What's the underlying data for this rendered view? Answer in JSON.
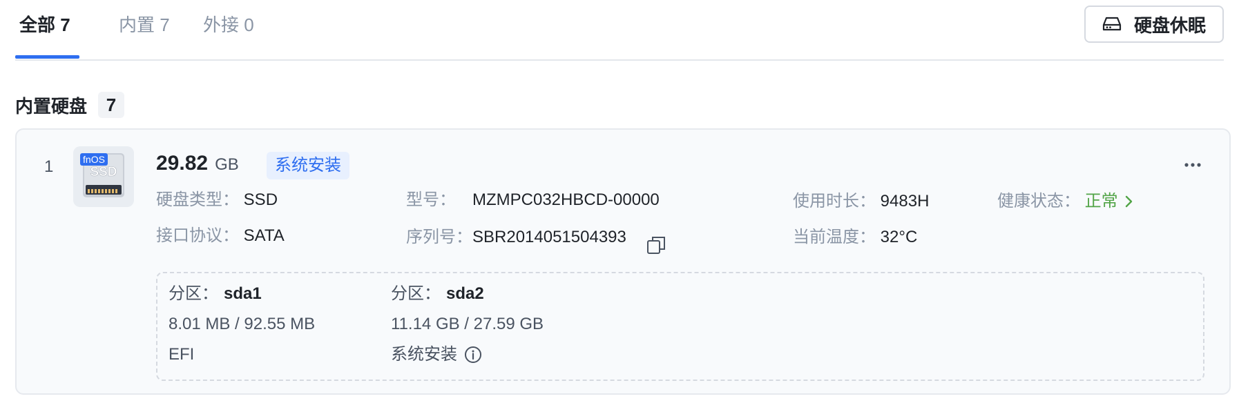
{
  "tabs": [
    {
      "label": "全部 7",
      "active": true
    },
    {
      "label": "内置 7",
      "active": false
    },
    {
      "label": "外接 0",
      "active": false
    }
  ],
  "sleep_button": {
    "label": "硬盘休眠",
    "icon": "hard-drive-icon"
  },
  "section": {
    "title": "内置硬盘",
    "count": "7"
  },
  "disk": {
    "index": "1",
    "image": {
      "badge": "fnOS",
      "label": "SSD"
    },
    "size_value": "29.82",
    "size_unit": "GB",
    "tag": "系统安装",
    "fields": {
      "type": {
        "key": "硬盘类型：",
        "value": "SSD"
      },
      "interface": {
        "key": "接口协议：",
        "value": "SATA"
      },
      "model": {
        "key": "型号：",
        "value": "MZMPC032HBCD-00000"
      },
      "serial": {
        "key": "序列号：",
        "value": "SBR2014051504393"
      },
      "uptime": {
        "key": "使用时长：",
        "value": "9483H"
      },
      "temperature": {
        "key": "当前温度：",
        "value": "32°C"
      },
      "health": {
        "key": "健康状态：",
        "value": "正常"
      }
    },
    "partitions": [
      {
        "label": "分区：",
        "name": "sda1",
        "usage": "8.01 MB / 92.55 MB",
        "fs": "EFI"
      },
      {
        "label": "分区：",
        "name": "sda2",
        "usage": "11.14 GB / 27.59 GB",
        "fs": "系统安装"
      }
    ]
  },
  "colors": {
    "accent": "#2e6ef0",
    "health_ok": "#52a447",
    "tag_bg": "#e8f0fe"
  }
}
